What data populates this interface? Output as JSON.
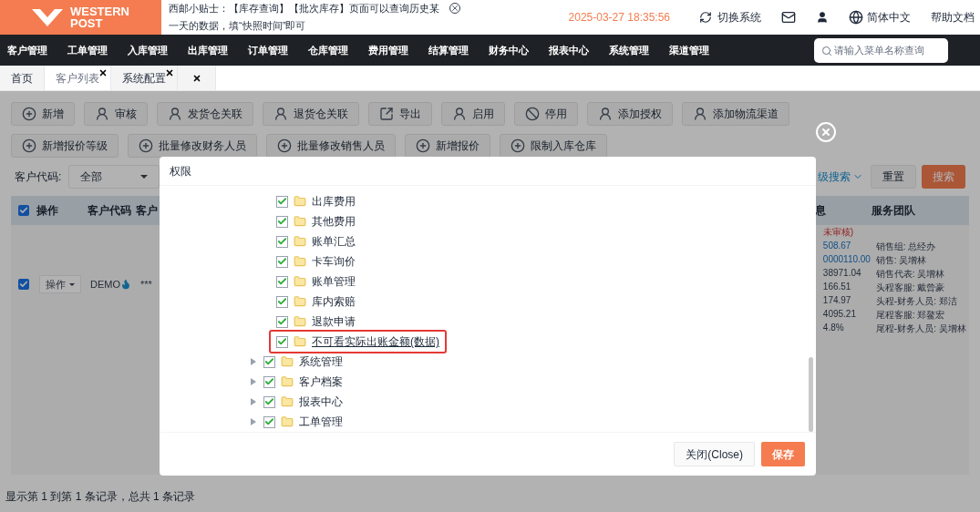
{
  "header": {
    "logo_line1": "WESTERN",
    "logo_line2": "POST",
    "notice": "西邮小贴士：【库存查询】【批次库存】页面可以查询历史某一天的数据，填“快照时间”即可",
    "datetime": "2025-03-27 18:35:56",
    "actions": [
      {
        "kind": "switch",
        "label": "切换系统"
      },
      {
        "kind": "mail"
      },
      {
        "kind": "user"
      },
      {
        "kind": "language",
        "label": "简体中文"
      },
      {
        "kind": "help",
        "label": "帮助文档"
      }
    ]
  },
  "nav": {
    "items": [
      "客户管理",
      "工单管理",
      "入库管理",
      "出库管理",
      "订单管理",
      "仓库管理",
      "费用管理",
      "结算管理",
      "财务中心",
      "报表中心",
      "系统管理",
      "渠道管理"
    ],
    "search": {
      "placeholder": "请输入菜单名称查询"
    }
  },
  "tabs": [
    {
      "label": "首页",
      "selected": false,
      "closable": false
    },
    {
      "label": "客户列表",
      "selected": true,
      "closable": true
    },
    {
      "label": "系统配置",
      "selected": false,
      "closable": true
    },
    {
      "selected": false,
      "closable": true
    }
  ],
  "toolbar": [
    {
      "kind": "add",
      "label": "新增"
    },
    {
      "kind": "person",
      "label": "审核"
    },
    {
      "kind": "person",
      "label": "发货仓关联"
    },
    {
      "kind": "person",
      "label": "退货仓关联"
    },
    {
      "kind": "export",
      "label": "导出"
    },
    {
      "kind": "person",
      "label": "启用"
    },
    {
      "kind": "disable",
      "label": "停用"
    },
    {
      "kind": "person",
      "label": "添加授权"
    },
    {
      "kind": "person",
      "label": "添加物流渠道"
    },
    {
      "kind": "add",
      "label": "新增报价等级"
    },
    {
      "kind": "add",
      "label": "批量修改财务人员"
    },
    {
      "kind": "add",
      "label": "批量修改销售人员"
    },
    {
      "kind": "add",
      "label": "新增报价"
    },
    {
      "kind": "add",
      "label": "限制入库仓库"
    }
  ],
  "filter": {
    "label": "客户代码:",
    "value": "全部",
    "advanced_search": "级搜索",
    "reset": "重置",
    "search": "搜索"
  },
  "table": {
    "header_checked": true,
    "columns": [
      "操作",
      "客户代码",
      "客户",
      "息",
      "服务团队"
    ],
    "rows": [
      {
        "checked": true,
        "action": "操作",
        "code": "DEMO",
        "column_3": "***",
        "info": [
          {
            "kind": "warning",
            "text": "未审核)"
          },
          {
            "kind": "link",
            "text": "508.67"
          },
          {
            "kind": "link",
            "text": "0000110.00"
          },
          {
            "kind": "plain",
            "text": "38971.04"
          },
          {
            "kind": "plain",
            "text": "166.51"
          },
          {
            "kind": "plain",
            "text": "174.97"
          },
          {
            "kind": "plain",
            "text": "4095.21"
          },
          {
            "kind": "plain",
            "text": "4.8%"
          }
        ],
        "team": [
          "销售组: 总经办",
          "销售: 吴增林",
          "销售代表: 吴增林",
          "头程客服: 戴曾豪",
          "头程-财务人员: 郑洁",
          "尾程客服: 郑鳌宏",
          "尾程-财务人员: 吴增林"
        ]
      }
    ]
  },
  "footer": "显示第 1 到第 1 条记录，总共 1 条记录",
  "dialog": {
    "title": "权限",
    "tree": [
      {
        "children": [
          {
            "label": "出库费用",
            "checked": true,
            "highlighted": false
          },
          {
            "label": "其他费用",
            "checked": true,
            "highlighted": false
          },
          {
            "label": "账单汇总",
            "checked": true,
            "highlighted": false
          },
          {
            "label": "卡车询价",
            "checked": true,
            "highlighted": false
          },
          {
            "label": "账单管理",
            "checked": true,
            "highlighted": false
          },
          {
            "label": "库内索赔",
            "checked": true,
            "highlighted": false
          },
          {
            "label": "退款申请",
            "checked": true,
            "highlighted": false
          },
          {
            "label": "不可看实际出账金额(数据)",
            "checked": true,
            "highlighted": true
          }
        ]
      },
      {
        "label": "系统管理",
        "checked": true,
        "expanded": false,
        "highlighted": false
      },
      {
        "label": "客户档案",
        "checked": true,
        "expanded": false,
        "highlighted": false
      },
      {
        "label": "报表中心",
        "checked": true,
        "expanded": false,
        "highlighted": false
      },
      {
        "label": "工单管理",
        "checked": true,
        "expanded": false,
        "highlighted": false
      }
    ],
    "buttons": [
      {
        "kind": "default",
        "label": "关闭(Close)"
      },
      {
        "kind": "primary",
        "label": "保存"
      }
    ]
  }
}
